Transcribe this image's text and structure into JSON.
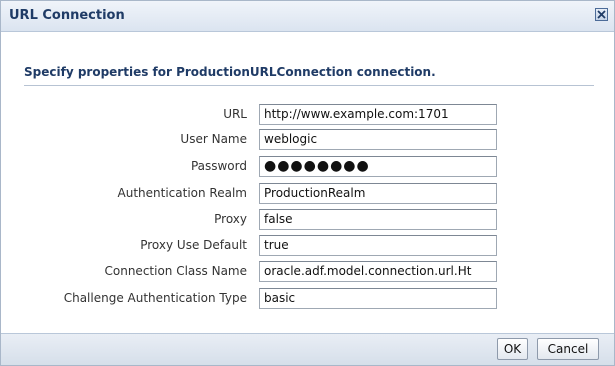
{
  "dialog": {
    "title": "URL Connection",
    "close_icon": "close-x-icon",
    "heading": "Specify properties for ProductionURLConnection connection."
  },
  "fields": [
    {
      "label": "URL",
      "value": "http://www.example.com:1701"
    },
    {
      "label": "User Name",
      "value": "weblogic"
    },
    {
      "label": "Password",
      "value": "●●●●●●●●"
    },
    {
      "label": "Authentication Realm",
      "value": "ProductionRealm"
    },
    {
      "label": "Proxy",
      "value": "false"
    },
    {
      "label": "Proxy Use Default",
      "value": "true"
    },
    {
      "label": "Connection Class Name",
      "value": "oracle.adf.model.connection.url.Ht"
    },
    {
      "label": "Challenge Authentication Type",
      "value": "basic"
    }
  ],
  "buttons": {
    "ok": "OK",
    "cancel": "Cancel"
  },
  "colors": {
    "title_text": "#1f3b66",
    "title_bar": "#dbe4f0",
    "border": "#a9b7c9"
  }
}
